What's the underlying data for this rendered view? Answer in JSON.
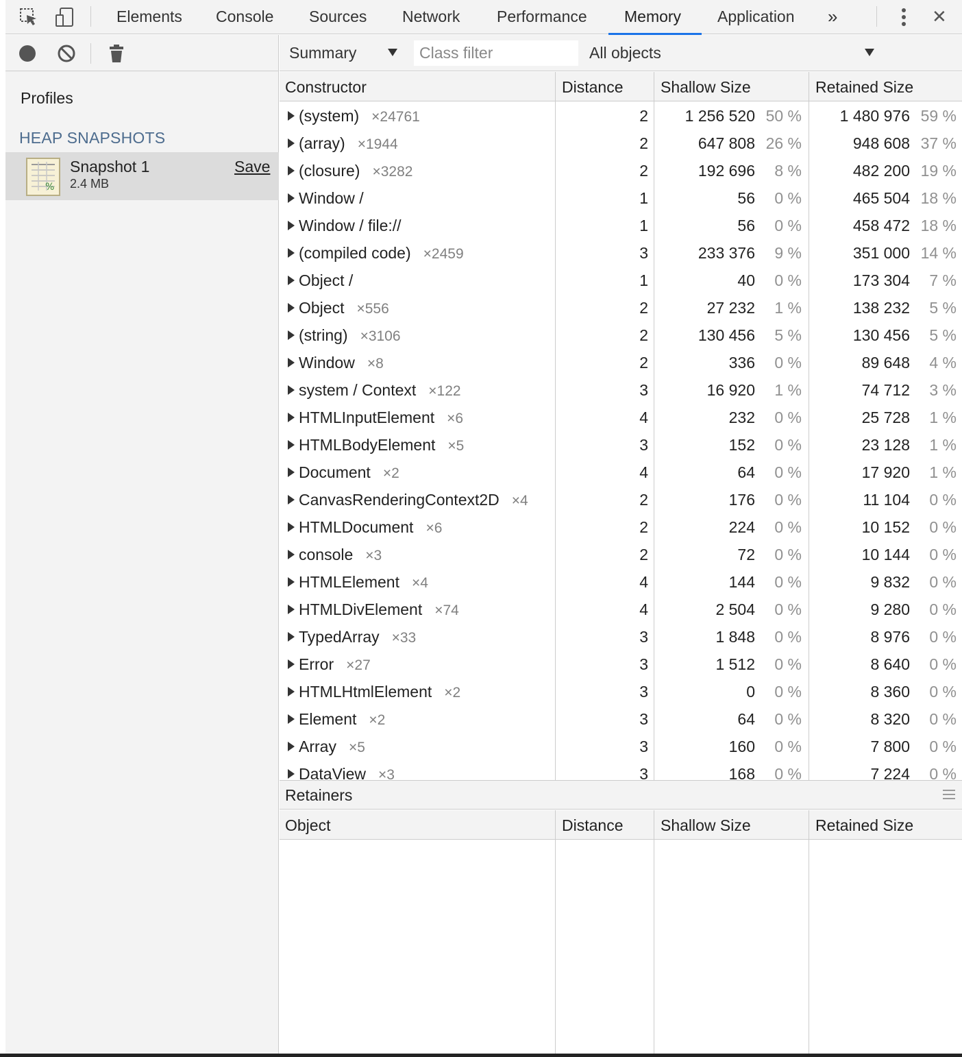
{
  "toolbar_tabs": {
    "tabs": [
      {
        "label": "Elements"
      },
      {
        "label": "Console"
      },
      {
        "label": "Sources"
      },
      {
        "label": "Network"
      },
      {
        "label": "Performance"
      },
      {
        "label": "Memory",
        "active": true
      },
      {
        "label": "Application"
      }
    ],
    "more": "»",
    "close": "✕",
    "accent_color": "#1a73e8"
  },
  "sidebar": {
    "title": "Profiles",
    "section": "HEAP SNAPSHOTS",
    "snapshot": {
      "name": "Snapshot 1",
      "size": "2.4 MB",
      "save_label": "Save"
    }
  },
  "main_toolbar": {
    "view": "Summary",
    "class_filter_placeholder": "Class filter",
    "scope": "All objects"
  },
  "heap_table": {
    "columns": [
      "Constructor",
      "Distance",
      "Shallow Size",
      "Retained Size"
    ],
    "rows": [
      {
        "name": "(system)",
        "count": "×24761",
        "distance": "2",
        "shallow": "1 256 520",
        "shallow_pct": "50 %",
        "retained": "1 480 976",
        "retained_pct": "59 %"
      },
      {
        "name": "(array)",
        "count": "×1944",
        "distance": "2",
        "shallow": "647 808",
        "shallow_pct": "26 %",
        "retained": "948 608",
        "retained_pct": "37 %"
      },
      {
        "name": "(closure)",
        "count": "×3282",
        "distance": "2",
        "shallow": "192 696",
        "shallow_pct": "8 %",
        "retained": "482 200",
        "retained_pct": "19 %"
      },
      {
        "name": "Window /",
        "count": "",
        "distance": "1",
        "shallow": "56",
        "shallow_pct": "0 %",
        "retained": "465 504",
        "retained_pct": "18 %"
      },
      {
        "name": "Window / file://",
        "count": "",
        "distance": "1",
        "shallow": "56",
        "shallow_pct": "0 %",
        "retained": "458 472",
        "retained_pct": "18 %"
      },
      {
        "name": "(compiled code)",
        "count": "×2459",
        "distance": "3",
        "shallow": "233 376",
        "shallow_pct": "9 %",
        "retained": "351 000",
        "retained_pct": "14 %"
      },
      {
        "name": "Object /",
        "count": "",
        "distance": "1",
        "shallow": "40",
        "shallow_pct": "0 %",
        "retained": "173 304",
        "retained_pct": "7 %"
      },
      {
        "name": "Object",
        "count": "×556",
        "distance": "2",
        "shallow": "27 232",
        "shallow_pct": "1 %",
        "retained": "138 232",
        "retained_pct": "5 %"
      },
      {
        "name": "(string)",
        "count": "×3106",
        "distance": "2",
        "shallow": "130 456",
        "shallow_pct": "5 %",
        "retained": "130 456",
        "retained_pct": "5 %"
      },
      {
        "name": "Window",
        "count": "×8",
        "distance": "2",
        "shallow": "336",
        "shallow_pct": "0 %",
        "retained": "89 648",
        "retained_pct": "4 %"
      },
      {
        "name": "system / Context",
        "count": "×122",
        "distance": "3",
        "shallow": "16 920",
        "shallow_pct": "1 %",
        "retained": "74 712",
        "retained_pct": "3 %"
      },
      {
        "name": "HTMLInputElement",
        "count": "×6",
        "distance": "4",
        "shallow": "232",
        "shallow_pct": "0 %",
        "retained": "25 728",
        "retained_pct": "1 %"
      },
      {
        "name": "HTMLBodyElement",
        "count": "×5",
        "distance": "3",
        "shallow": "152",
        "shallow_pct": "0 %",
        "retained": "23 128",
        "retained_pct": "1 %"
      },
      {
        "name": "Document",
        "count": "×2",
        "distance": "4",
        "shallow": "64",
        "shallow_pct": "0 %",
        "retained": "17 920",
        "retained_pct": "1 %"
      },
      {
        "name": "CanvasRenderingContext2D",
        "count": "×4",
        "distance": "2",
        "shallow": "176",
        "shallow_pct": "0 %",
        "retained": "11 104",
        "retained_pct": "0 %"
      },
      {
        "name": "HTMLDocument",
        "count": "×6",
        "distance": "2",
        "shallow": "224",
        "shallow_pct": "0 %",
        "retained": "10 152",
        "retained_pct": "0 %"
      },
      {
        "name": "console",
        "count": "×3",
        "distance": "2",
        "shallow": "72",
        "shallow_pct": "0 %",
        "retained": "10 144",
        "retained_pct": "0 %"
      },
      {
        "name": "HTMLElement",
        "count": "×4",
        "distance": "4",
        "shallow": "144",
        "shallow_pct": "0 %",
        "retained": "9 832",
        "retained_pct": "0 %"
      },
      {
        "name": "HTMLDivElement",
        "count": "×74",
        "distance": "4",
        "shallow": "2 504",
        "shallow_pct": "0 %",
        "retained": "9 280",
        "retained_pct": "0 %"
      },
      {
        "name": "TypedArray",
        "count": "×33",
        "distance": "3",
        "shallow": "1 848",
        "shallow_pct": "0 %",
        "retained": "8 976",
        "retained_pct": "0 %"
      },
      {
        "name": "Error",
        "count": "×27",
        "distance": "3",
        "shallow": "1 512",
        "shallow_pct": "0 %",
        "retained": "8 640",
        "retained_pct": "0 %"
      },
      {
        "name": "HTMLHtmlElement",
        "count": "×2",
        "distance": "3",
        "shallow": "0",
        "shallow_pct": "0 %",
        "retained": "8 360",
        "retained_pct": "0 %"
      },
      {
        "name": "Element",
        "count": "×2",
        "distance": "3",
        "shallow": "64",
        "shallow_pct": "0 %",
        "retained": "8 320",
        "retained_pct": "0 %"
      },
      {
        "name": "Array",
        "count": "×5",
        "distance": "3",
        "shallow": "160",
        "shallow_pct": "0 %",
        "retained": "7 800",
        "retained_pct": "0 %"
      },
      {
        "name": "DataView",
        "count": "×3",
        "distance": "3",
        "shallow": "168",
        "shallow_pct": "0 %",
        "retained": "7 224",
        "retained_pct": "0 %"
      }
    ]
  },
  "retainers": {
    "title": "Retainers",
    "columns": [
      "Object",
      "Distance",
      "Shallow Size",
      "Retained Size"
    ]
  }
}
